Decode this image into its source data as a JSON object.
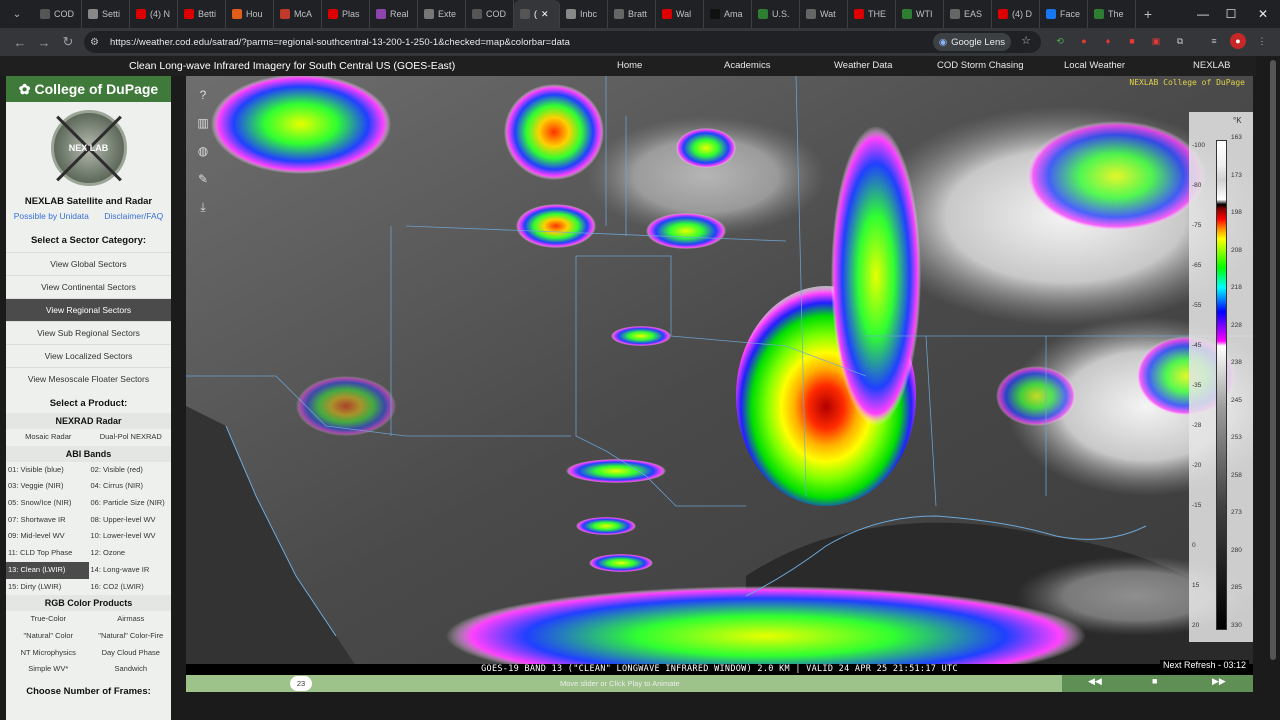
{
  "browser": {
    "tabs": [
      {
        "label": "COD",
        "color": "#555"
      },
      {
        "label": "Setti",
        "color": "#888"
      },
      {
        "label": "(4) N",
        "color": "#d00"
      },
      {
        "label": "Betti",
        "color": "#d00"
      },
      {
        "label": "Hou",
        "color": "#e25c1a"
      },
      {
        "label": "McA",
        "color": "#c0392b"
      },
      {
        "label": "Plas",
        "color": "#d00"
      },
      {
        "label": "Real",
        "color": "#8e44ad"
      },
      {
        "label": "Exte",
        "color": "#777"
      },
      {
        "label": "COD",
        "color": "#555"
      },
      {
        "label": "(",
        "color": "#555",
        "active": true
      },
      {
        "label": "Inbc",
        "color": "#888"
      },
      {
        "label": "Bratt",
        "color": "#666"
      },
      {
        "label": "Wal",
        "color": "#d00"
      },
      {
        "label": "Ama",
        "color": "#111"
      },
      {
        "label": "U.S.",
        "color": "#2e7d32"
      },
      {
        "label": "Wat",
        "color": "#666"
      },
      {
        "label": "THE",
        "color": "#d00"
      },
      {
        "label": "WTI",
        "color": "#2e7d32"
      },
      {
        "label": "EAS",
        "color": "#666"
      },
      {
        "label": "(4) D",
        "color": "#d00"
      },
      {
        "label": "Face",
        "color": "#1877f2"
      },
      {
        "label": "The",
        "color": "#2e7d32"
      }
    ],
    "url": "https://weather.cod.edu/satrad/?parms=regional-southcentral-13-200-1-250-1&checked=map&colorbar=data",
    "lens_label": "Google Lens"
  },
  "site": {
    "page_title": "Clean Long-wave Infrared Imagery for South Central US (GOES-East)",
    "nav": [
      "Home",
      "Academics",
      "Weather Data",
      "COD Storm Chasing",
      "Local Weather",
      "NEXLAB"
    ]
  },
  "sidebar": {
    "brand": "College of DuPage",
    "logo_text": "NEX  LAB",
    "title": "NEXLAB Satellite and Radar",
    "link_left": "Possible by Unidata",
    "link_right": "Disclaimer/FAQ",
    "sector_heading": "Select a Sector Category:",
    "sectors": [
      {
        "label": "View Global Sectors"
      },
      {
        "label": "View Continental Sectors"
      },
      {
        "label": "View Regional Sectors",
        "selected": true
      },
      {
        "label": "View Sub Regional Sectors"
      },
      {
        "label": "View Localized Sectors"
      },
      {
        "label": "View Mesoscale Floater Sectors"
      }
    ],
    "product_heading": "Select a Product:",
    "nexrad_heading": "NEXRAD Radar",
    "nexrad": [
      "Mosaic Radar",
      "Dual-Pol NEXRAD"
    ],
    "abi_heading": "ABI Bands",
    "abi": [
      {
        "label": "01: Visible (blue)"
      },
      {
        "label": "02: Visible (red)"
      },
      {
        "label": "03: Veggie (NIR)"
      },
      {
        "label": "04: Cirrus (NIR)"
      },
      {
        "label": "05: Snow/Ice (NIR)"
      },
      {
        "label": "06: Particle Size (NIR)"
      },
      {
        "label": "07: Shortwave IR"
      },
      {
        "label": "08: Upper-level WV"
      },
      {
        "label": "09: Mid-level WV"
      },
      {
        "label": "10: Lower-level WV"
      },
      {
        "label": "11: CLD Top Phase"
      },
      {
        "label": "12: Ozone"
      },
      {
        "label": "13: Clean (LWIR)",
        "selected": true
      },
      {
        "label": "14: Long-wave IR"
      },
      {
        "label": "15: Dirty (LWIR)"
      },
      {
        "label": "16: CO2 (LWIR)"
      }
    ],
    "rgb_heading": "RGB Color Products",
    "rgb": [
      "True-Color",
      "Airmass",
      "\"Natural\" Color",
      "\"Natural\" Color-Fire",
      "NT Microphysics",
      "Day Cloud Phase",
      "Simple WV*",
      "Sandwich"
    ],
    "frames_heading": "Choose Number of Frames:"
  },
  "map": {
    "watermark": "NEXLAB College of DuPage",
    "caption": "GOES-19 BAND 13 (\"CLEAN\" LONGWAVE INFRARED WINDOW) 2.0 KM | VALID 24 APR 25 21:51:17 UTC",
    "next_refresh": "Next Refresh - 03:12",
    "colorbar": {
      "unit": "°K",
      "left_labels": [
        "-100",
        "-80",
        "-75",
        "-65",
        "-55",
        "-45",
        "-35",
        "-28",
        "-20",
        "-15",
        "0",
        "15",
        "20"
      ],
      "right_labels": [
        "163",
        "173",
        "198",
        "208",
        "218",
        "228",
        "238",
        "245",
        "253",
        "258",
        "273",
        "280",
        "285",
        "330"
      ]
    }
  },
  "animation": {
    "frame": "23",
    "hint": "Move slider or Click Play to Animate"
  }
}
